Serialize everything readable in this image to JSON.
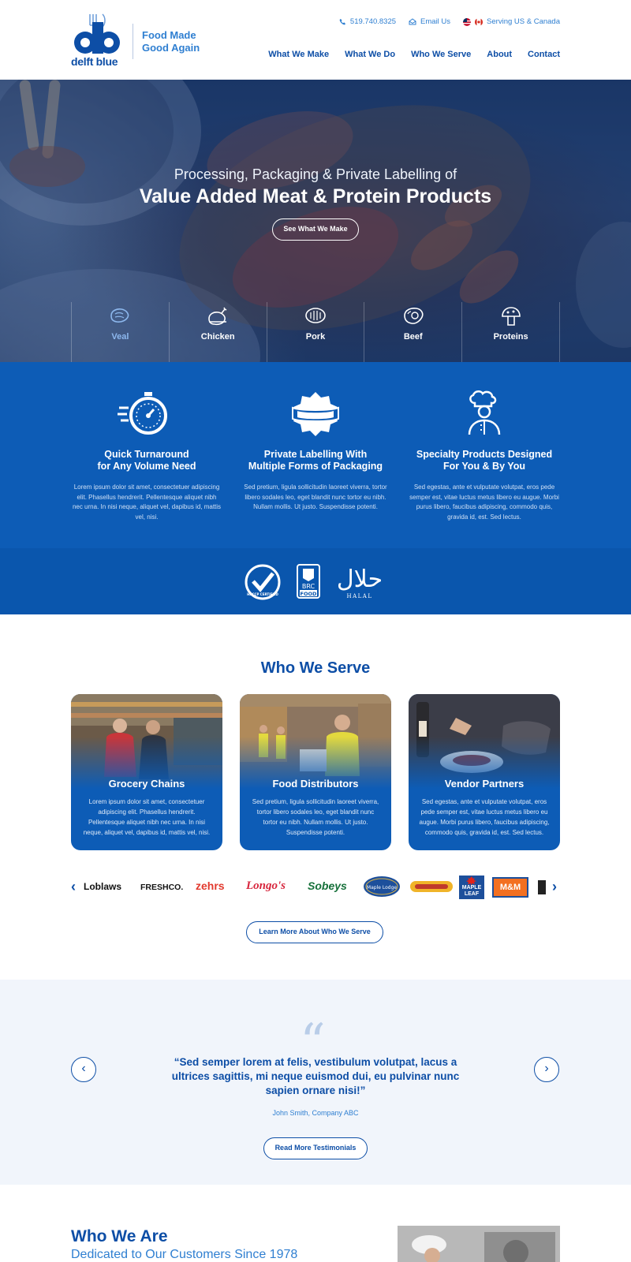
{
  "brand": {
    "logo_mark": "db",
    "logo_word": "delft blue",
    "tagline_line1": "Food Made",
    "tagline_line2": "Good Again",
    "primary_color": "#0d4ea6",
    "accent_color": "#2f7fd1"
  },
  "topbar": {
    "phone": "519.740.8325",
    "email": "Email Us",
    "region": "Serving US & Canada"
  },
  "nav": [
    "What We Make",
    "What We Do",
    "Who We Serve",
    "About",
    "Contact"
  ],
  "hero": {
    "subtitle": "Processing, Packaging & Private Labelling of",
    "title": "Value Added Meat & Protein Products",
    "button": "See What We Make",
    "categories": [
      {
        "label": "Veal",
        "icon": "veal-icon"
      },
      {
        "label": "Chicken",
        "icon": "chicken-icon"
      },
      {
        "label": "Pork",
        "icon": "pork-icon"
      },
      {
        "label": "Beef",
        "icon": "beef-icon"
      },
      {
        "label": "Proteins",
        "icon": "mushroom-icon"
      }
    ]
  },
  "features": [
    {
      "title_line1": "Quick Turnaround",
      "title_line2": "for Any Volume Need",
      "text": "Lorem ipsum dolor sit amet, consectetuer adipiscing elit. Phasellus hendrerit. Pellentesque aliquet nibh nec urna. In nisi neque, aliquet vel, dapibus id, mattis vel, nisi.",
      "icon": "stopwatch-icon"
    },
    {
      "title_line1": "Private Labelling With",
      "title_line2": "Multiple Forms of Packaging",
      "text": "Sed pretium, ligula sollicitudin laoreet viverra, tortor libero sodales leo, eget blandit nunc tortor eu nibh. Nullam mollis. Ut justo. Suspendisse potenti.",
      "icon": "label-badge-icon"
    },
    {
      "title_line1": "Specialty Products Designed",
      "title_line2": "For You & By You",
      "text": "Sed egestas, ante et vulputate volutpat, eros pede semper est, vitae luctus metus libero eu augue. Morbi purus libero, faucibus adipiscing, commodo quis, gravida id, est. Sed lectus.",
      "icon": "chef-icon"
    }
  ],
  "certifications": {
    "haccp": "HACCP CERTIFIED",
    "brc_line1": "BRC",
    "brc_line2": "FOOD",
    "halal_arabic": "حلال",
    "halal_latin": "HALAL"
  },
  "serve": {
    "title": "Who We Serve",
    "cards": [
      {
        "title": "Grocery Chains",
        "text": "Lorem ipsum dolor sit amet, consectetuer adipiscing elit. Phasellus hendrerit. Pellentesque aliquet nibh nec urna. In nisi neque, aliquet vel, dapibus id, mattis vel, nisi."
      },
      {
        "title": "Food Distributors",
        "text": "Sed pretium, ligula sollicitudin laoreet viverra, tortor libero sodales leo, eget blandit nunc tortor eu nibh. Nullam mollis. Ut justo. Suspendisse potenti."
      },
      {
        "title": "Vendor Partners",
        "text": "Sed egestas, ante et vulputate volutpat, eros pede semper est, vitae luctus metus libero eu augue. Morbi purus libero, faucibus adipiscing, commodo quis, gravida id, est. Sed lectus."
      }
    ],
    "brands": [
      "Loblaws",
      "FRESHCO.",
      "zehrs",
      "Longo's",
      "Sobeys",
      "Maple Lodge",
      "",
      "MAPLE LEAF",
      "M&M"
    ],
    "button": "Learn More About Who We Serve"
  },
  "testimonial": {
    "quote": "“Sed semper lorem at felis, vestibulum volutpat, lacus a ultrices sagittis, mi neque euismod dui, eu pulvinar nunc sapien ornare nisi!”",
    "author": "John Smith, Company ABC",
    "button": "Read More Testimonials"
  },
  "about": {
    "title": "Who We Are",
    "subtitle": "Dedicated to Our Customers Since 1978"
  }
}
